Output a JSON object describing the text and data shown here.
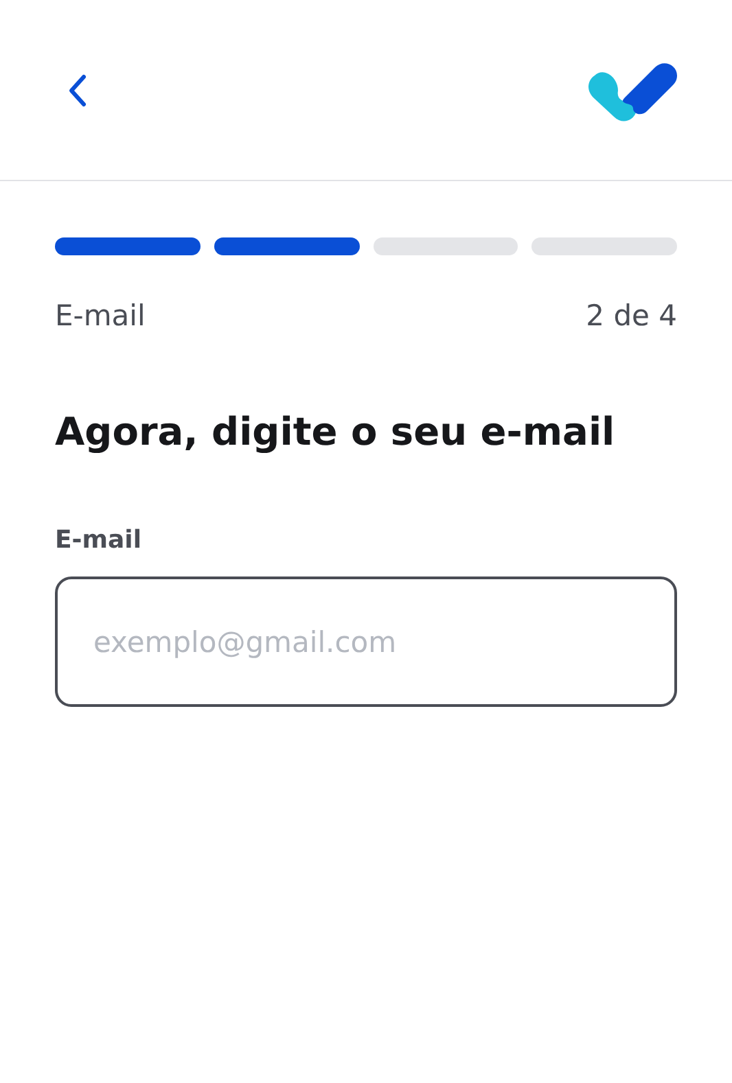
{
  "progress": {
    "steps": [
      {
        "selected": true
      },
      {
        "selected": true
      },
      {
        "selected": false
      },
      {
        "selected": false
      }
    ],
    "label": "E-mail",
    "count": "2 de 4"
  },
  "heading": "Agora, digite o seu e-mail",
  "field": {
    "label": "E-mail",
    "placeholder": "exemplo@gmail.com"
  }
}
